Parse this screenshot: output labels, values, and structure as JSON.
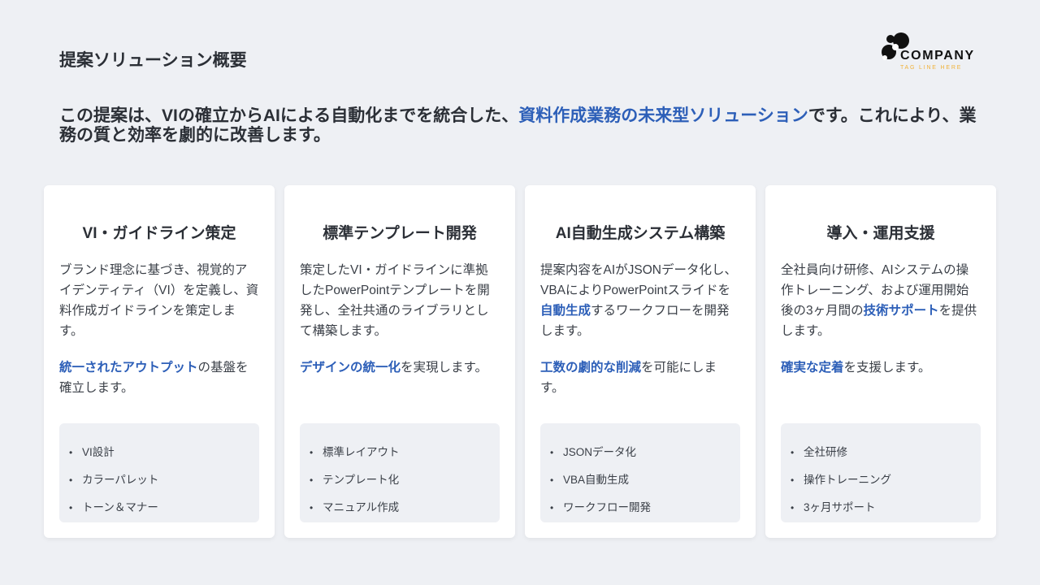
{
  "header": {
    "title": "提案ソリューション概要",
    "logo": {
      "name": "COMPANY",
      "tagline": "TAG LINE HERE",
      "icon": "company-logo-icon"
    }
  },
  "lead": {
    "part1": "この提案は、VIの確立からAIによる自動化までを統合した、",
    "highlight": "資料作成業務の未来型ソリューション",
    "part2": "です。これにより、業務の質と効率を劇的に改善します。"
  },
  "colors": {
    "accent": "#2d5fb8",
    "tagline": "#f0b23a",
    "background": "#eef0f4",
    "card": "#ffffff"
  },
  "cards": [
    {
      "title": "VI・ガイドライン策定",
      "p1": [
        {
          "t": "ブランド理念に基づき、視覚的アイデンティティ（VI）を定義し、資料作成ガイドラインを策定します。",
          "hl": false
        }
      ],
      "p2": [
        {
          "t": "統一されたアウトプット",
          "hl": true
        },
        {
          "t": "の基盤を確立します。",
          "hl": false
        }
      ],
      "bullets": [
        "VI設計",
        "カラーパレット",
        "トーン＆マナー"
      ]
    },
    {
      "title": "標準テンプレート開発",
      "p1": [
        {
          "t": "策定したVI・ガイドラインに準拠したPowerPointテンプレートを開発し、全社共通のライブラリとして構築します。",
          "hl": false
        }
      ],
      "p2": [
        {
          "t": "デザインの統一化",
          "hl": true
        },
        {
          "t": "を実現します。",
          "hl": false
        }
      ],
      "bullets": [
        "標準レイアウト",
        "テンプレート化",
        "マニュアル作成"
      ]
    },
    {
      "title": "AI自動生成システム構築",
      "p1": [
        {
          "t": "提案内容をAIがJSONデータ化し、VBAによりPowerPointスライドを",
          "hl": false
        },
        {
          "t": "自動生成",
          "hl": true
        },
        {
          "t": "するワークフローを開発します。",
          "hl": false
        }
      ],
      "p2": [
        {
          "t": "工数の劇的な削減",
          "hl": true
        },
        {
          "t": "を可能にします。",
          "hl": false
        }
      ],
      "bullets": [
        "JSONデータ化",
        "VBA自動生成",
        "ワークフロー開発"
      ]
    },
    {
      "title": "導入・運用支援",
      "p1": [
        {
          "t": "全社員向け研修、AIシステムの操作トレーニング、および運用開始後の3ヶ月間の",
          "hl": false
        },
        {
          "t": "技術サポート",
          "hl": true
        },
        {
          "t": "を提供します。",
          "hl": false
        }
      ],
      "p2": [
        {
          "t": "確実な定着",
          "hl": true
        },
        {
          "t": "を支援します。",
          "hl": false
        }
      ],
      "bullets": [
        "全社研修",
        "操作トレーニング",
        "3ヶ月サポート"
      ]
    }
  ]
}
